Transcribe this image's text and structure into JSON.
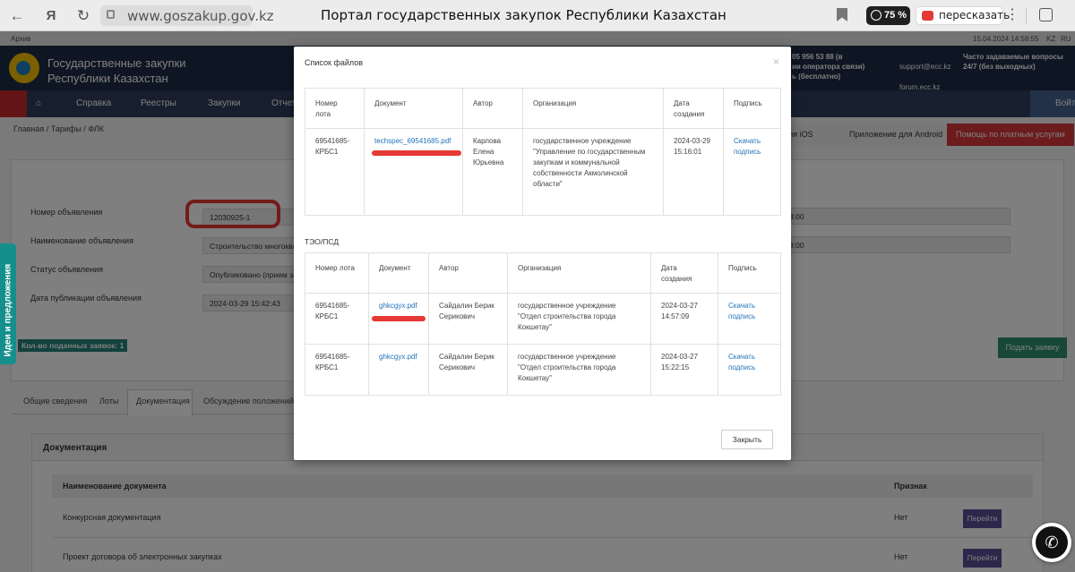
{
  "browser": {
    "url": "www.goszakup.gov.kz",
    "tab_title": "Портал государственных закупок Республики Казахстан",
    "zoom": "75 %",
    "retell_label": "пересказать"
  },
  "site": {
    "top_left": "Архив",
    "top_right": "15.04.2024 14:58:55",
    "lang_kz": "KZ",
    "lang_ru": "RU",
    "title_line1": "Государственные закупки",
    "title_line2": "Республики Казахстан",
    "contact_phone": "05 956 53 88 (в",
    "contact_line2": "ии оператора связи)",
    "contact_line3": "ь (бесплатно)",
    "email": "support@ecc.kz",
    "forum": "forum.ecc.kz",
    "faq": "Часто задаваемые вопросы",
    "support_hours": "24/7 (без выходных)",
    "nav": {
      "help": "Справка",
      "registries": "Реестры",
      "purchases": "Закупки",
      "reports": "Отчет",
      "logout": "Войти"
    },
    "breadcrumb": [
      "Главная",
      "Тарифы",
      "ФЛК"
    ],
    "btn_ios": "ля iOS",
    "btn_android": "Приложение для Android",
    "btn_help": "Помощь по платным услугам",
    "fields": [
      {
        "label": "Номер объявления",
        "value": "12030925-1"
      },
      {
        "label": "Наименование объявления",
        "value": "Строительство многоквар"
      },
      {
        "label": "Статус объявления",
        "value": "Опубликовано (прием заяв"
      },
      {
        "label": "Дата публикации объявления",
        "value": "2024-03-29 15:42:43"
      }
    ],
    "right_field_1": "3:00",
    "right_field_2": "3:00",
    "kolvo": "Кол-во поданных заявок: 1",
    "submit_label": "Подать заявку",
    "tabs": [
      "Общие сведения",
      "Лоты",
      "Документация",
      "Обсуждение положений д"
    ],
    "ideas_label": "Идеи и предложения",
    "docs": {
      "title": "Документация",
      "col_name": "Наименование документа",
      "col_sign": "Признак",
      "rows": [
        {
          "name": "Конкурсная документация",
          "sign": "Нет",
          "btn": "Перейти"
        },
        {
          "name": "Проект договора об электронных закупках",
          "sign": "Нет",
          "btn": "Перейти"
        }
      ]
    }
  },
  "modal": {
    "title": "Список файлов",
    "headers": [
      "Номер лота",
      "Документ",
      "Автор",
      "Организация",
      "Дата создания",
      "Подпись"
    ],
    "files": [
      {
        "lot": "69541685-КРБС1",
        "doc": "techspec_69541685.pdf",
        "author": "Карлова Елена Юрьевна",
        "org": "государственное учреждение \"Управление по государственным закупкам и коммунальной собственности Акмолинской области\"",
        "date": "2024-03-29 15:16:01",
        "sign": "Скачать подпись"
      }
    ],
    "teo_title": "ТЭО/ПСД",
    "teo": [
      {
        "lot": "69541685-КРБС1",
        "doc": "ghkcgyx.pdf",
        "author": "Сайдалин Берик Серикович",
        "org": "государственное учреждение \"Отдел строительства города Кокшетау\"",
        "date": "2024-03-27 14:57:09",
        "sign": "Скачать подпись"
      },
      {
        "lot": "69541685-КРБС1",
        "doc": "ghkcgyx.pdf",
        "author": "Сайдалин Берик Серикович",
        "org": "государственное учреждение \"Отдел строительства города Кокшетау\"",
        "date": "2024-03-27 15:22:15",
        "sign": "Скачать подпись"
      }
    ],
    "close_label": "Закрыть"
  },
  "colors": {
    "header": "#1e2d47",
    "accent_teal": "#158f8b",
    "link": "#2373b8",
    "annotation_red": "#e53935"
  }
}
